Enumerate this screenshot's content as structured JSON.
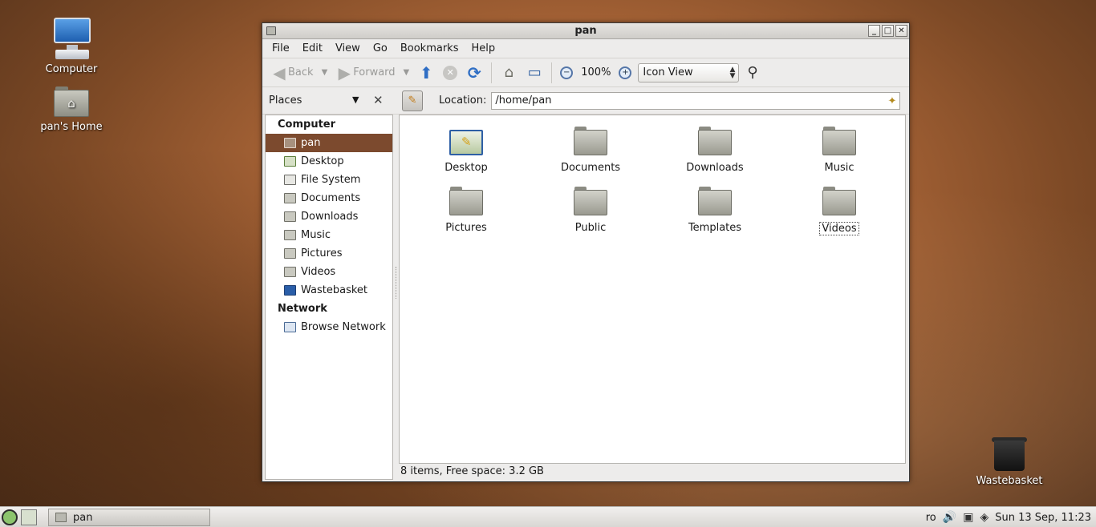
{
  "desktop": {
    "icons": [
      {
        "label": "Computer"
      },
      {
        "label": "pan's Home"
      },
      {
        "label": "Wastebasket"
      }
    ]
  },
  "window": {
    "title": "pan",
    "menu": [
      "File",
      "Edit",
      "View",
      "Go",
      "Bookmarks",
      "Help"
    ],
    "toolbar": {
      "back": "Back",
      "forward": "Forward",
      "zoom": "100%",
      "view_mode": "Icon View"
    },
    "places_label": "Places",
    "location_label": "Location:",
    "location_value": "/home/pan",
    "sidebar": {
      "computer_header": "Computer",
      "computer_items": [
        "pan",
        "Desktop",
        "File System",
        "Documents",
        "Downloads",
        "Music",
        "Pictures",
        "Videos",
        "Wastebasket"
      ],
      "network_header": "Network",
      "network_items": [
        "Browse Network"
      ]
    },
    "files": [
      "Desktop",
      "Documents",
      "Downloads",
      "Music",
      "Pictures",
      "Public",
      "Templates",
      "Videos"
    ],
    "status": "8 items, Free space: 3.2 GB"
  },
  "taskbar": {
    "task": "pan",
    "keyboard": "ro",
    "clock": "Sun 13 Sep, 11:23"
  },
  "colors": {
    "selection": "#7c4a2e",
    "accent_blue": "#2f6ec4"
  }
}
